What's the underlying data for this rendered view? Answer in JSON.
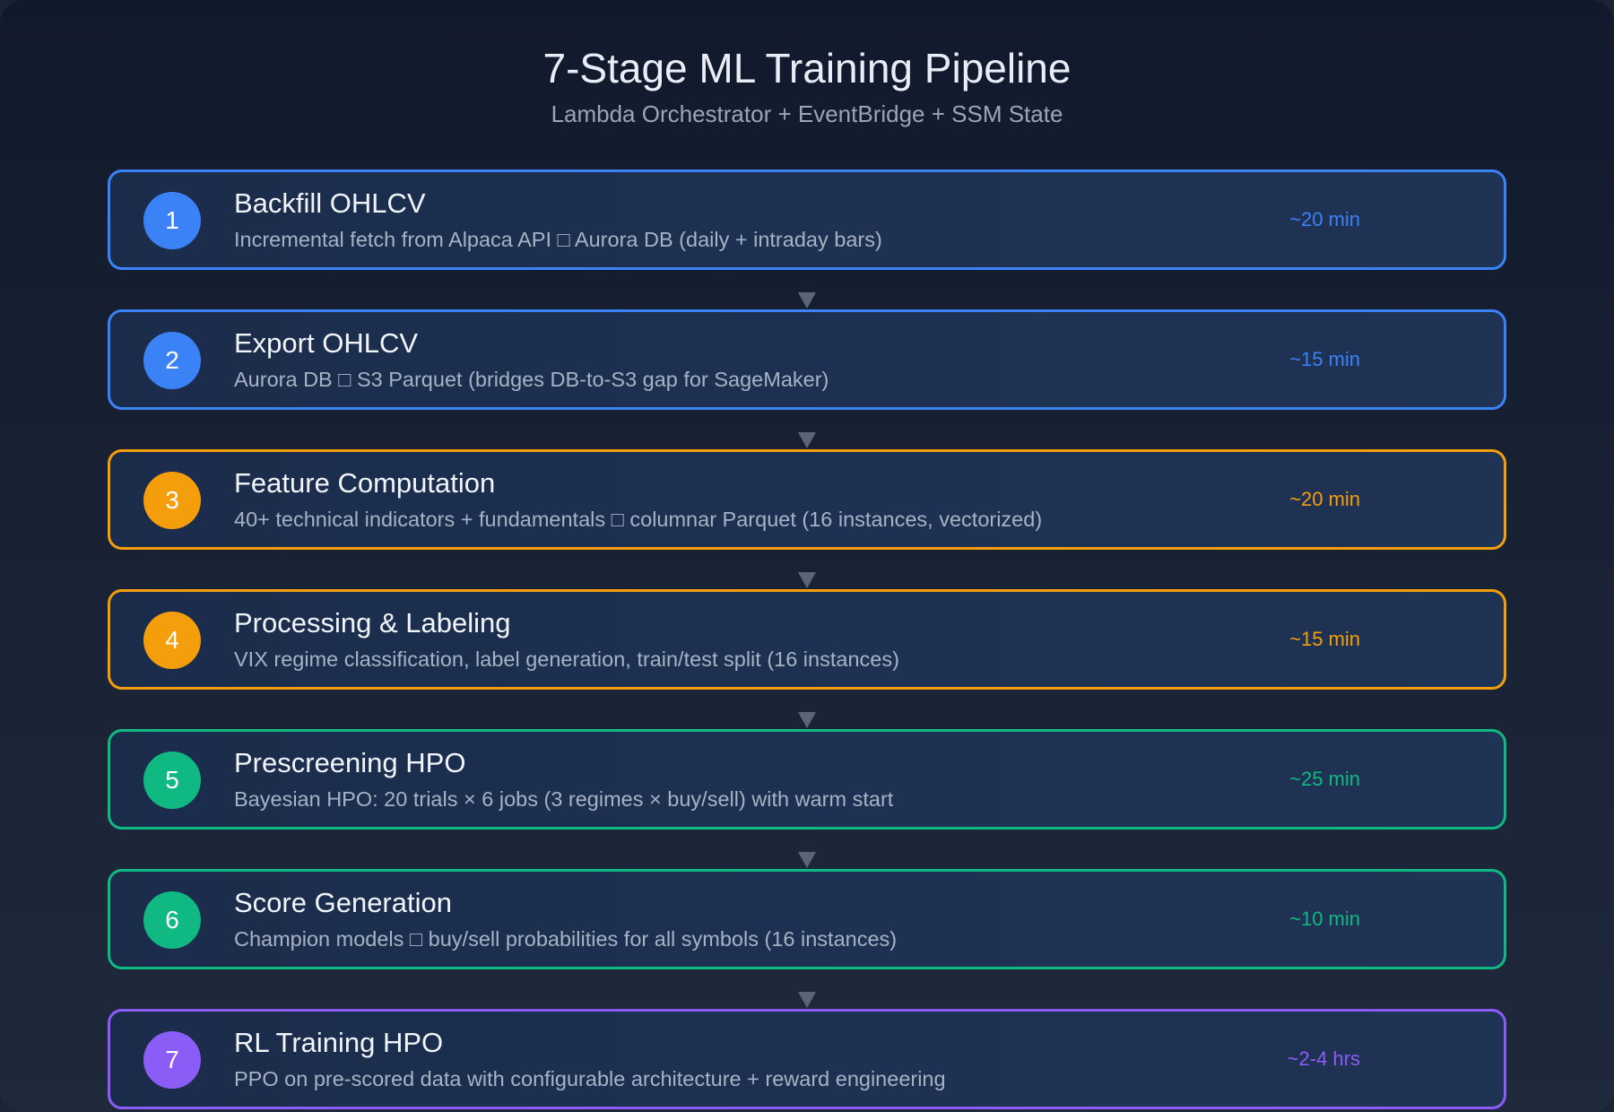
{
  "title": "7-Stage ML Training Pipeline",
  "subtitle": "Lambda Orchestrator + EventBridge + SSM State",
  "stages": [
    {
      "number": "1",
      "title": "Backfill OHLCV",
      "description": "Incremental fetch from Alpaca API □ Aurora DB (daily + intraday bars)",
      "duration": "~20 min",
      "color": "#3b82f6"
    },
    {
      "number": "2",
      "title": "Export OHLCV",
      "description": "Aurora DB □ S3 Parquet (bridges DB-to-S3 gap for SageMaker)",
      "duration": "~15 min",
      "color": "#3b82f6"
    },
    {
      "number": "3",
      "title": "Feature Computation",
      "description": "40+ technical indicators + fundamentals □ columnar Parquet (16 instances, vectorized)",
      "duration": "~20 min",
      "color": "#f59e0b"
    },
    {
      "number": "4",
      "title": "Processing & Labeling",
      "description": "VIX regime classification, label generation, train/test split (16 instances)",
      "duration": "~15 min",
      "color": "#f59e0b"
    },
    {
      "number": "5",
      "title": "Prescreening HPO",
      "description": "Bayesian HPO: 20 trials × 6 jobs (3 regimes × buy/sell) with warm start",
      "duration": "~25 min",
      "color": "#10b981"
    },
    {
      "number": "6",
      "title": "Score Generation",
      "description": "Champion models □ buy/sell probabilities for all symbols (16 instances)",
      "duration": "~10 min",
      "color": "#10b981"
    },
    {
      "number": "7",
      "title": "RL Training HPO",
      "description": "PPO on pre-scored data with configurable architecture + reward engineering",
      "duration": "~2-4 hrs",
      "color": "#8b5cf6"
    }
  ],
  "colors": {
    "blue": "#3b82f6",
    "amber": "#f59e0b",
    "green": "#10b981",
    "purple": "#8b5cf6",
    "connector": "#5b6577"
  },
  "icons": {
    "connector": "down-arrow-icon"
  }
}
